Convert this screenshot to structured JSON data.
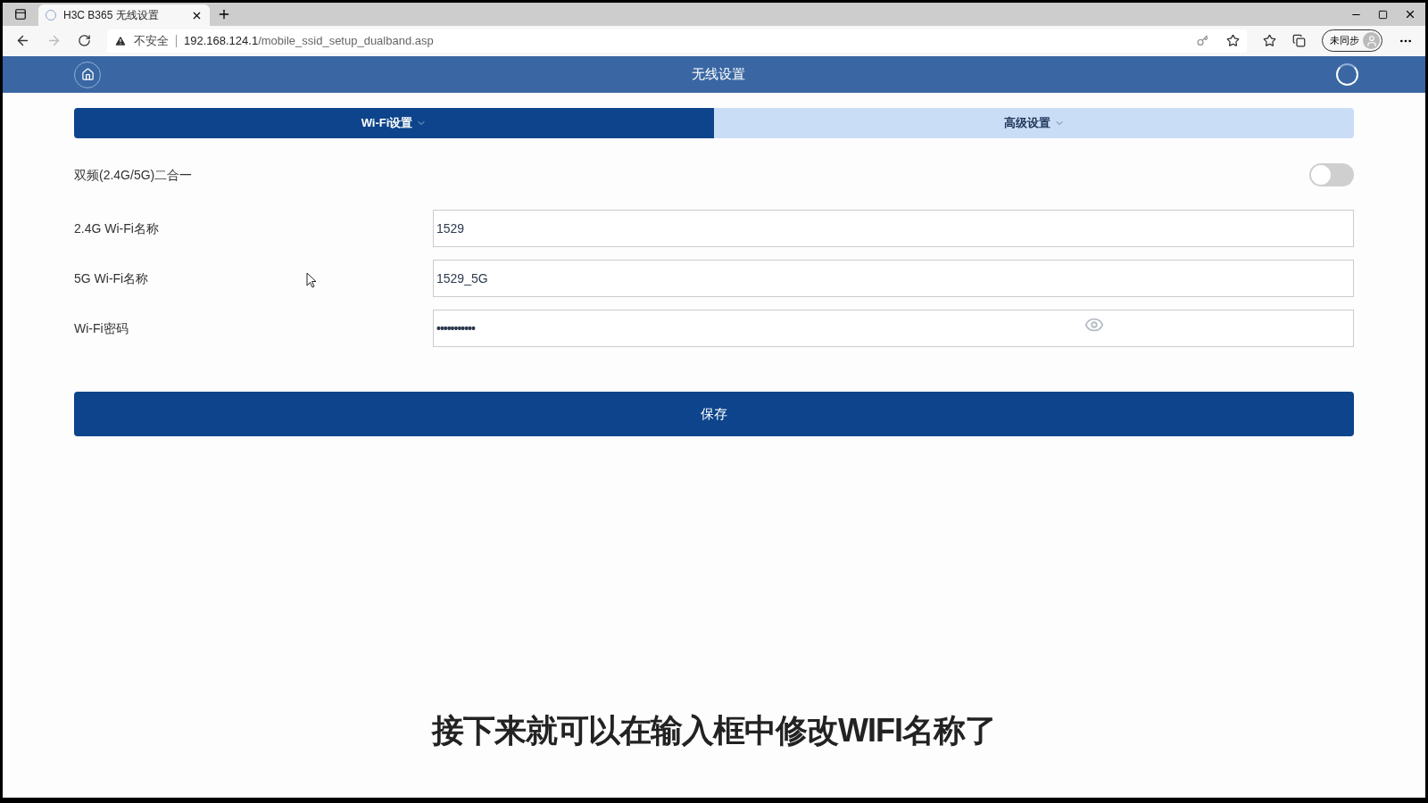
{
  "browser": {
    "tab_title": "H3C B365 无线设置",
    "security_label": "不安全",
    "url_host": "192.168.124.1",
    "url_path": "/mobile_ssid_setup_dualband.asp",
    "profile_label": "未同步"
  },
  "header": {
    "title": "无线设置"
  },
  "tabs": [
    {
      "label": "Wi-Fi设置",
      "selected": true
    },
    {
      "label": "高级设置",
      "selected": false
    }
  ],
  "dual_band": {
    "label": "双频(2.4G/5G)二合一",
    "on": false
  },
  "fields": [
    {
      "label": "2.4G Wi-Fi名称",
      "value": "1529",
      "kind": "text"
    },
    {
      "label": "5G Wi-Fi名称",
      "value": "1529_5G",
      "kind": "text"
    },
    {
      "label": "Wi-Fi密码",
      "value": "•••••••••••",
      "kind": "password"
    }
  ],
  "save_button": "保存",
  "subtitle": "接下来就可以在输入框中修改WIFI名称了"
}
